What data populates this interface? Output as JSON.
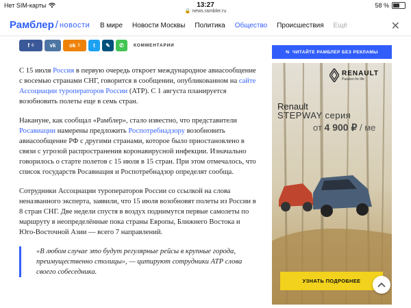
{
  "status": {
    "carrier": "Нет SIM-карты",
    "time": "13:27",
    "url": "news.rambler.ru",
    "battery": "58 %",
    "battery_level": 0.58
  },
  "nav": {
    "logo_main": "Рамблер",
    "logo_sub": "новости",
    "links": [
      "В мире",
      "Новости Москвы",
      "Политика",
      "Общество",
      "Происшествия",
      "Ещё"
    ],
    "active": "Общество",
    "close_icon": "close-icon"
  },
  "share": {
    "facebook_count": "6",
    "ok_count": "5",
    "comments_label": "КОММЕНТАРИИ",
    "colors": {
      "facebook": "#3b5998",
      "vk": "#4c75a3",
      "ok": "#ee8208",
      "twitter": "#1da1f2",
      "lj": "#00517c",
      "whatsapp": "#43c553"
    }
  },
  "article": {
    "p1_a": "С 15 июля ",
    "p1_link1": "Россия",
    "p1_b": " в первую очередь откроет международное авиасообщение с восемью странами СНГ, говорится в сообщении, опубликованном на ",
    "p1_link2": "сайте Ассоциации туроператоров России",
    "p1_c": " (АТР). С 1 августа планируется возобновить полеты еще в семь стран.",
    "p2_a": "Накануне, как сообщал «Рамблер», стало известно, что представители ",
    "p2_link1": "Росавиации",
    "p2_b": " намерены предложить ",
    "p2_link2": "Роспотребнадзору",
    "p2_c": " возобновить авиасообщение РФ с другими странами, которое было приостановлено в связи с угрозой распространения коронавирусной инфекции. Изначально говорилось о старте полетов с 15 июля в 15 стран. При этом отмечалось, что список государств Росавиация и Роспотребнадзор определят сообща.",
    "p3": "Сотрудники Ассоциации туроператоров России со ссылкой на слова неназванного эксперта, заявили, что 15 июля возобновят полеты из России в 8 стран СНГ. Две недели спустя в воздух поднимутся первые самолеты по маршруту в неопределённые пока страны Европы, Ближнего Востока и Юго-Восточной Азии — всего 7 направлений.",
    "quote": "«В любом случае это будут регулярные рейсы в крупные города, преимущественно столицы», — цитируют сотрудники АТР слова своего собеседника."
  },
  "ad": {
    "label": "ЧИТАЙТЕ РАМБЛЕР БЕЗ РЕКЛАМЫ",
    "brand_logo": "RENAULT",
    "brand_tagline": "Passion for life",
    "brand": "Renault",
    "model": "STEPWAY серия",
    "price_prefix": "от ",
    "price": "4 900 ₽",
    "price_suffix": " / ме",
    "cta": "УЗНАТЬ ПОДРОБНЕЕ"
  }
}
